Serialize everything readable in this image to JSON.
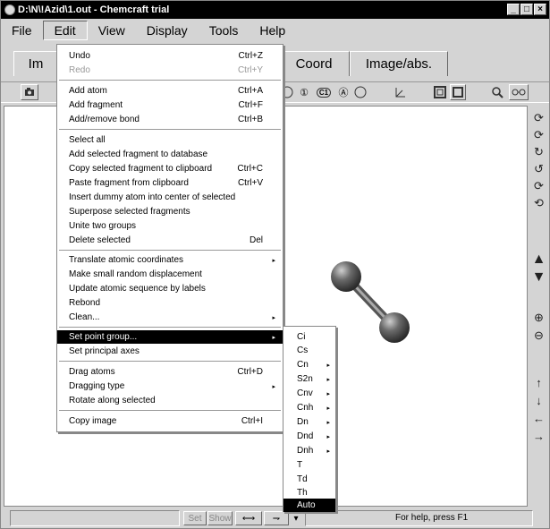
{
  "window": {
    "title": "D:\\N\\!Azid\\1.out - Chemcraft trial",
    "min": "_",
    "max": "□",
    "close": "×"
  },
  "menubar": [
    "File",
    "Edit",
    "View",
    "Display",
    "Tools",
    "Help"
  ],
  "tabs": {
    "left": "Im",
    "coord": "Coord",
    "image": "Image/abs."
  },
  "toolbar": {
    "c1": "C1",
    "atom": "Ⓐ",
    "one": "①"
  },
  "edit_menu": [
    {
      "label": "Undo",
      "shortcut": "Ctrl+Z"
    },
    {
      "label": "Redo",
      "shortcut": "Ctrl+Y",
      "disabled": true
    },
    {
      "label": "Add atom",
      "shortcut": "Ctrl+A"
    },
    {
      "label": "Add fragment",
      "shortcut": "Ctrl+F"
    },
    {
      "label": "Add/remove bond",
      "shortcut": "Ctrl+B"
    },
    {
      "label": "Select all",
      "shortcut": ""
    },
    {
      "label": "Add selected fragment to database",
      "shortcut": ""
    },
    {
      "label": "Copy selected fragment to clipboard",
      "shortcut": "Ctrl+C"
    },
    {
      "label": "Paste fragment from clipboard",
      "shortcut": "Ctrl+V"
    },
    {
      "label": "Insert dummy atom into center of selected",
      "shortcut": ""
    },
    {
      "label": "Superpose selected fragments",
      "shortcut": ""
    },
    {
      "label": "Unite two groups",
      "shortcut": ""
    },
    {
      "label": "Delete selected",
      "shortcut": "Del"
    },
    {
      "label": "Translate atomic coordinates",
      "shortcut": ""
    },
    {
      "label": "Make small random displacement",
      "shortcut": ""
    },
    {
      "label": "Update atomic sequence by labels",
      "shortcut": ""
    },
    {
      "label": "Rebond",
      "shortcut": ""
    },
    {
      "label": "Clean...",
      "shortcut": ""
    },
    {
      "label": "Set point group...",
      "shortcut": ""
    },
    {
      "label": "Set principal axes",
      "shortcut": ""
    },
    {
      "label": "Drag atoms",
      "shortcut": "Ctrl+D"
    },
    {
      "label": "Dragging type",
      "shortcut": ""
    },
    {
      "label": "Rotate along selected",
      "shortcut": ""
    },
    {
      "label": "Copy image",
      "shortcut": "Ctrl+I"
    }
  ],
  "point_groups": [
    "Ci",
    "Cs",
    "Cn",
    "S2n",
    "Cnv",
    "Cnh",
    "Dn",
    "Dnd",
    "Dnh",
    "T",
    "Td",
    "Th",
    "Auto"
  ],
  "status": {
    "set": "Set",
    "show": "Show",
    "help": "For help, press F1"
  },
  "icons": {
    "camera": "camera-icon",
    "arrow": "▸",
    "down": "▾"
  }
}
